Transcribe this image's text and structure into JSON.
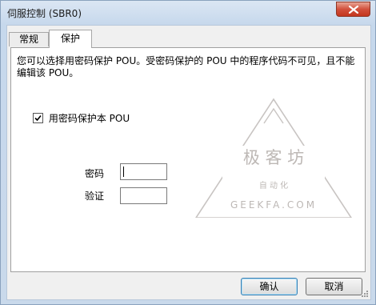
{
  "window": {
    "title": "伺服控制 (SBR0)",
    "close_icon": "close-icon"
  },
  "tabs": [
    {
      "label": "常规",
      "active": false
    },
    {
      "label": "保护",
      "active": true
    }
  ],
  "protect_tab": {
    "description": "您可以选择用密码保护 POU。受密码保护的 POU 中的程序代码不可见，且不能编辑该 POU。",
    "checkbox_label": "用密码保护本 POU",
    "checkbox_checked": true,
    "password_label": "密码",
    "password_value": "",
    "verify_label": "验证",
    "verify_value": ""
  },
  "watermark": {
    "main": "极 客 坊",
    "sub": "自 动 化",
    "url": "GEEKFA.COM"
  },
  "buttons": {
    "ok": "确认",
    "cancel": "取消"
  },
  "colors": {
    "titlebar": "#c6d8ec",
    "close_button": "#c94a34",
    "watermark": "#c8c4c2",
    "default_button_border": "#3c7fb1"
  }
}
